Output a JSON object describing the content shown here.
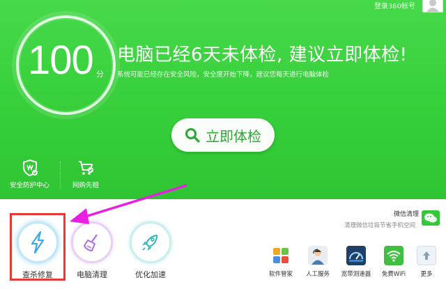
{
  "header": {
    "login_label": "登录360帐号"
  },
  "score": {
    "value": "100",
    "unit": "分"
  },
  "headline": "电脑已经6天未体检, 建议立即体检!",
  "subline": "系统可能已经存在安全风险，安全度开始下降，建议您每天进行电脑体检",
  "check_button": {
    "label": "立即体检"
  },
  "hero_tools": [
    {
      "label": "安全防护中心",
      "icon": "shield-check-icon"
    },
    {
      "label": "网购先赔",
      "icon": "cart-check-icon"
    }
  ],
  "wechat": {
    "title": "微信清理",
    "subtitle": "清理微信垃圾节省手机空间",
    "icon": "wechat-icon"
  },
  "main_tools": [
    {
      "label": "查杀修复",
      "icon": "lightning-icon",
      "color": "#3aa8e8"
    },
    {
      "label": "电脑清理",
      "icon": "broom-icon",
      "color": "#b06ee0"
    },
    {
      "label": "优化加速",
      "icon": "rocket-icon",
      "color": "#2ab3b8"
    }
  ],
  "mini_tools": [
    {
      "label": "软件管家",
      "icon": "apps-icon"
    },
    {
      "label": "人工服务",
      "icon": "service-person-icon"
    },
    {
      "label": "宽带测速器",
      "icon": "speedometer-icon"
    },
    {
      "label": "免费WiFi",
      "icon": "wifi-icon"
    },
    {
      "label": "更多",
      "icon": "arrow-up-icon"
    }
  ],
  "colors": {
    "hero_green": "#3dd340",
    "button_text": "#2aa830",
    "highlight_red": "#e53935",
    "arrow_magenta": "#e91ee3"
  }
}
